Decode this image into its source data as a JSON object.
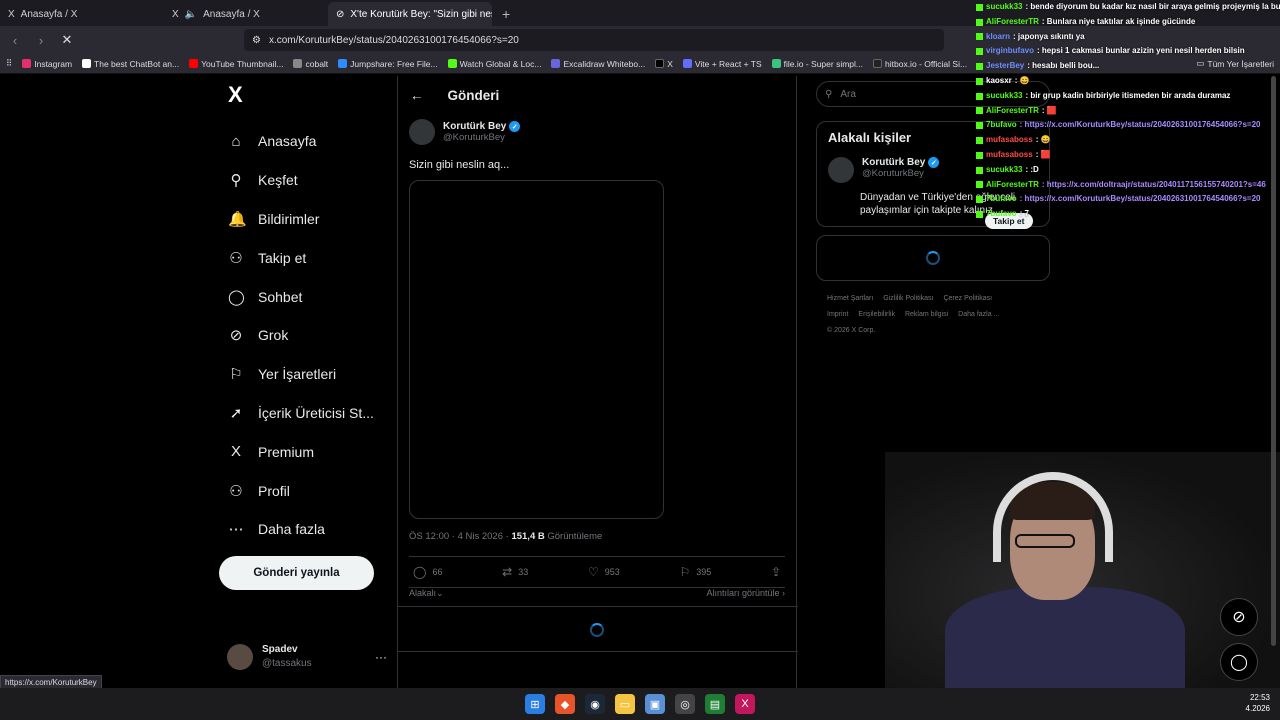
{
  "browser": {
    "tabs": [
      {
        "icon": "X",
        "title": "Anasayfa / X"
      },
      {
        "icon": "X",
        "title": "Anasayfa / X"
      },
      {
        "icon": "⊘",
        "title": "X'te Korutürk Bey: \"Sizin gibi nes"
      }
    ],
    "url": "x.com/KoruturkBey/status/2040263100176454066?s=20",
    "bookmarks": [
      {
        "label": "Instagram",
        "color": "#e1306c"
      },
      {
        "label": "The best ChatBot an...",
        "color": "#ffffff"
      },
      {
        "label": "YouTube Thumbnail...",
        "color": "#ff0000"
      },
      {
        "label": "cobalt",
        "color": "#888888"
      },
      {
        "label": "Jumpshare: Free File...",
        "color": "#2d8cff"
      },
      {
        "label": "Watch Global & Loc...",
        "color": "#53fc18"
      },
      {
        "label": "Excalidraw Whitebo...",
        "color": "#6965db"
      },
      {
        "label": "X",
        "color": "#000000"
      },
      {
        "label": "Vite + React + TS",
        "color": "#646cff"
      },
      {
        "label": "file.io - Super simpl...",
        "color": "#3ac47d"
      },
      {
        "label": "hitbox.io - Official Si...",
        "color": "#222222"
      }
    ],
    "bookmarks_folder": "Tüm Yer İşaretleri",
    "status_url": "https://x.com/KoruturkBey"
  },
  "nav": {
    "logo": "X",
    "items": [
      {
        "icon": "⌂",
        "label": "Anasayfa"
      },
      {
        "icon": "⚲",
        "label": "Keşfet"
      },
      {
        "icon": "🔔",
        "label": "Bildirimler"
      },
      {
        "icon": "⚇",
        "label": "Takip et"
      },
      {
        "icon": "◯",
        "label": "Sohbet"
      },
      {
        "icon": "⊘",
        "label": "Grok"
      },
      {
        "icon": "⚐",
        "label": "Yer İşaretleri"
      },
      {
        "icon": "➚",
        "label": "İçerik Üreticisi St..."
      },
      {
        "icon": "X",
        "label": "Premium"
      },
      {
        "icon": "⚇",
        "label": "Profil"
      },
      {
        "icon": "⋯",
        "label": "Daha fazla"
      }
    ],
    "post_button": "Gönderi yayınla",
    "account": {
      "name": "Spadev",
      "handle": "@tassakus"
    }
  },
  "post": {
    "header": "Gönderi",
    "author": "Korutürk Bey",
    "handle": "@KoruturkBey",
    "text": "Sizin gibi neslin aq...",
    "time": "ÖS 12:00 · 4 Nis 2026 · ",
    "views": "151,4 B",
    "views_label": " Görüntüleme",
    "replies": "66",
    "reposts": "33",
    "likes": "953",
    "bookmarks": "395",
    "sort_label": "Alakalı",
    "quotes_label": "Alıntıları görüntüle"
  },
  "sidebar": {
    "search_placeholder": "Ara",
    "related_title": "Alakalı kişiler",
    "related_user": {
      "name": "Korutürk Bey",
      "handle": "@KoruturkBey",
      "bio": "Dünyadan ve Türkiye'den eğlenceli paylaşımlar için takipte kalınız.",
      "follow": "Takip et"
    },
    "footer_row1": [
      "Hizmet Şartları",
      "Gizlilik Politikası",
      "Çerez Politikası"
    ],
    "footer_row2": [
      "Imprint",
      "Erişilebilirlik",
      "Reklam bilgisi",
      "Daha fazla ..."
    ],
    "copyright": "© 2026 X Corp."
  },
  "chat": [
    {
      "user": "sucukk33",
      "color": "#53fc18",
      "text": ": bende diyorum bu kadar kız nasıl bir araya gelmiş projeymiş la bunlar"
    },
    {
      "user": "AliForesterTR",
      "color": "#53fc18",
      "text": ": Bunlara niye taktılar ak işinde gücünde"
    },
    {
      "user": "kloarn",
      "color": "#6c8cff",
      "text": ": japonya sıkıntı ya"
    },
    {
      "user": "virginbufavo",
      "color": "#6c8cff",
      "text": ": hepsi 1 cakmasi bunlar azizin yeni nesil herden bilsin"
    },
    {
      "user": "JesterBey",
      "color": "#6c8cff",
      "text": ": hesabı belli bou..."
    },
    {
      "user": "kaosxr",
      "color": "#ffffff",
      "text": ": 😄"
    },
    {
      "user": "sucukk33",
      "color": "#53fc18",
      "text": ": bir grup kadin birbiriyle itismeden bir arada duramaz"
    },
    {
      "user": "AliForesterTR",
      "color": "#53fc18",
      "text": ": 🟥"
    },
    {
      "user": "7bufavo",
      "color": "#53fc18",
      "text": ": https://x.com/KoruturkBey/status/2040263100176454066?s=20"
    },
    {
      "user": "mufasaboss",
      "color": "#ff4d4d",
      "text": ": 😄"
    },
    {
      "user": "mufasaboss",
      "color": "#ff4d4d",
      "text": ": 🟥"
    },
    {
      "user": "sucukk33",
      "color": "#53fc18",
      "text": ": :D"
    },
    {
      "user": "AliForesterTR",
      "color": "#53fc18",
      "text": ": https://x.com/doltraajr/status/2040117156155740201?s=46"
    },
    {
      "user": "7bufavo",
      "color": "#53fc18",
      "text": ": https://x.com/KoruturkBey/status/2040263100176454066?s=20"
    },
    {
      "user": "7bufavo",
      "color": "#53fc18",
      "text": ": 7"
    }
  ],
  "clock": {
    "time": "22:53",
    "date": "4.2026"
  }
}
